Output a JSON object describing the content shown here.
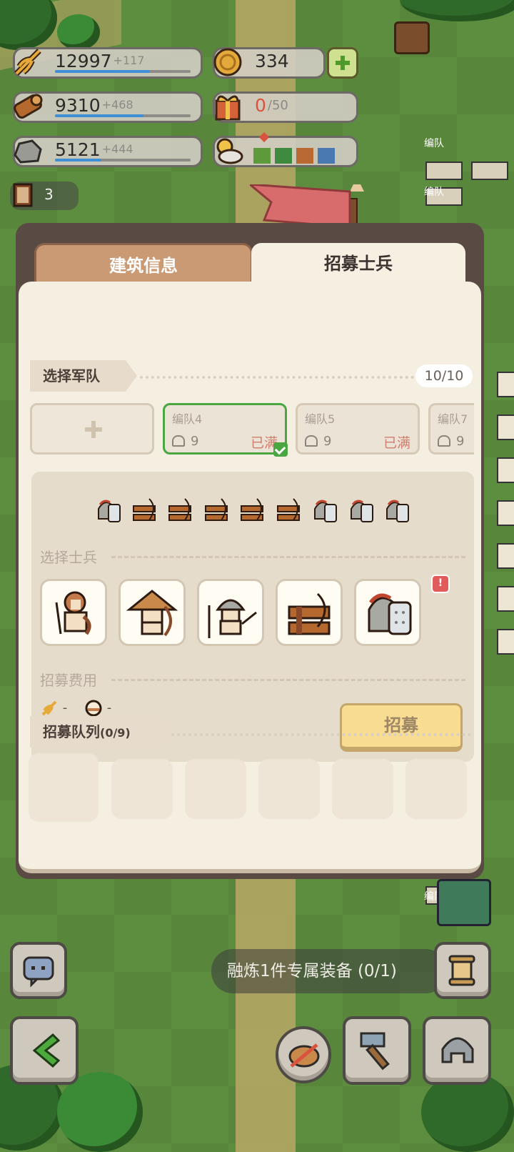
{
  "resources": {
    "food": {
      "value": "12997",
      "inc": "+117",
      "fill": 0.7
    },
    "wood": {
      "value": "9310",
      "inc": "+468",
      "fill": 0.65
    },
    "stone": {
      "value": "5121",
      "inc": "+444",
      "fill": 0.34
    },
    "gold": {
      "value": "334"
    },
    "gift": {
      "value": "0",
      "max": "/50"
    },
    "books": {
      "value": "3"
    }
  },
  "weather": {
    "colors": [
      "#5c9a3a",
      "#3e8a3e",
      "#b86a32",
      "#4a78b0"
    ]
  },
  "tabs": {
    "info": "建筑信息",
    "recruit": "招募士兵"
  },
  "select_army": {
    "title": "选择军队",
    "counter": "10/10"
  },
  "squads": [
    {
      "name": "",
      "icon": "plus-icon"
    },
    {
      "name": "编队4",
      "count": "9",
      "status": "已满",
      "selected": true
    },
    {
      "name": "编队5",
      "count": "9",
      "status": "已满",
      "selected": false
    },
    {
      "name": "编队7",
      "count": "9",
      "status": "",
      "selected": false
    }
  ],
  "select_soldier": {
    "title": "选择士兵"
  },
  "soldier_types": [
    "swordsman",
    "archer",
    "spearman",
    "crossbow",
    "shield"
  ],
  "cost": {
    "title": "招募费用",
    "food": "-",
    "gold": "-",
    "time": "-"
  },
  "recruit_button": "招募",
  "queue": {
    "title": "招募队列",
    "count": "(0/9)"
  },
  "quest": "融炼1件专属装备 (0/1)",
  "side_label": "编队",
  "colors": {
    "accent_green": "#4aa640",
    "tab_active": "#f6f0e3",
    "tab_inactive": "#c99a74"
  }
}
